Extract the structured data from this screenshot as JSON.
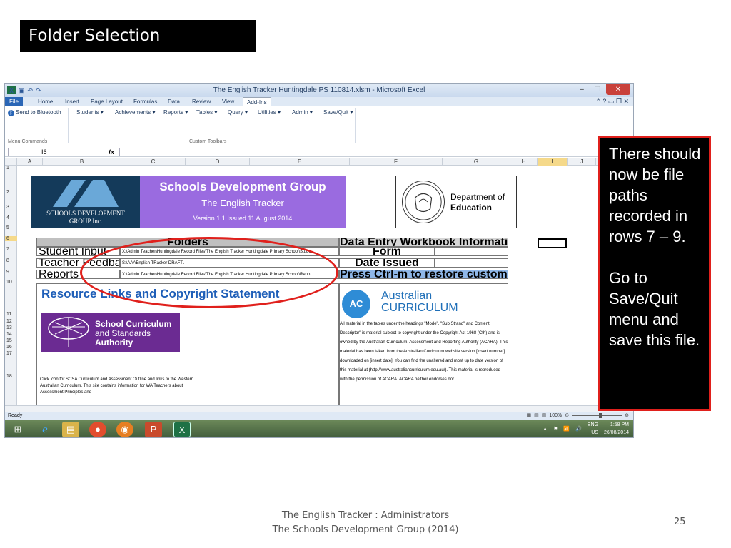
{
  "slide": {
    "title": "Folder Selection",
    "footer_line1": "The English Tracker :   Administrators",
    "footer_line2": "The Schools Development Group  (2014)",
    "page_number": "25",
    "callout_text": "There should now be file paths recorded in rows 7 – 9.\n\nGo to Save/Quit menu and save this file.",
    "accent_red": "#e0201c"
  },
  "window": {
    "title": "The English Tracker Huntingdale PS 110814.xlsm - Microsoft Excel",
    "qat": [
      "X",
      "save-icon",
      "undo-icon",
      "redo-icon"
    ],
    "controls": [
      "–",
      "❐",
      "✕"
    ]
  },
  "ribbon_tabs": [
    "File",
    "Home",
    "Insert",
    "Page Layout",
    "Formulas",
    "Data",
    "Review",
    "View",
    "Add-Ins"
  ],
  "ribbon": {
    "send_bluetooth": "Send to Bluetooth",
    "menus": [
      "Students ▾",
      "Achievements ▾",
      "Reports ▾",
      "Tables ▾",
      "Query ▾",
      "Utilities ▾",
      "Admin ▾",
      "Save/Quit ▾"
    ],
    "group_menu_commands": "Menu Commands",
    "group_custom_toolbars": "Custom Toolbars"
  },
  "formula_bar": {
    "name_box": "I6",
    "fx": "fx",
    "content": ""
  },
  "columns": [
    "A",
    "B",
    "C",
    "D",
    "E",
    "F",
    "G",
    "H",
    "I",
    "J"
  ],
  "rows": [
    "1",
    "2",
    "3",
    "4",
    "5",
    "6",
    "7",
    "8",
    "9",
    "10",
    "11",
    "12",
    "13",
    "14",
    "15",
    "16",
    "17",
    "18"
  ],
  "banner": {
    "sdg_line1": "SCHOOLS DEVELOPMENT",
    "sdg_line2": "GROUP Inc.",
    "title": "Schools Development Group",
    "subtitle": "The English Tracker",
    "version": "Version 1.1 Issued 11 August 2014",
    "doe_line1": "Department of",
    "doe_line2": "Education"
  },
  "folders": {
    "header": "Folders",
    "rows": [
      {
        "label": "Student Input",
        "path": "X:\\Admin Teacher\\Huntingdale Record Files\\The English Tracker Huntingdale Primary School\\Stude"
      },
      {
        "label": "Teacher Feedback Files",
        "path": "S:\\AAAEnglish TRacker DRAFT\\"
      },
      {
        "label": "Reports",
        "path": "X:\\Admin Teacher\\Huntingdale Record Files\\The English Tracker Huntingdale Primary School\\Repo"
      }
    ]
  },
  "data_entry": {
    "header": "Data Entry Workbook Information",
    "form": "Form",
    "date_issued": "Date Issued",
    "restore": "Press Ctrl-m to restore custom menus"
  },
  "resources": {
    "title": "Resource Links and Copyright Statement",
    "scsa_line1": "School Curriculum",
    "scsa_line2": "and Standards",
    "scsa_line3": "Authority",
    "body": "Click icon for SCSA Curriculum and Assessment Outline and links to the Western Australian Curriculum. This site contains information for WA Teachers about Assessment Principles and",
    "ac_badge": "AC",
    "ac_line1": "Australian",
    "ac_line2": "CURRICULUM",
    "copyright": "All material in the tables under the headings \"Mode\", \"Sub Strand\" and Content Descriptor\" is material subject to copyright under the Copyright Act 1968 (Cth) and is owned by the Australian Curriculum, Assessment and Reporting Authority (ACARA). This material has been taken from the Australian Curriculum website version [insert number] downloaded on [insert date]. You can find the unaltered and most up to date version of this material at (http://www.australiancurriculum.edu.au/). This material is reproduced with the permission of ACARA. ACARA neither endorses nor"
  },
  "status": {
    "ready": "Ready",
    "zoom": "100%"
  },
  "taskbar": {
    "lang1": "ENG",
    "lang2": "US",
    "time": "1:58 PM",
    "date": "26/08/2014"
  }
}
